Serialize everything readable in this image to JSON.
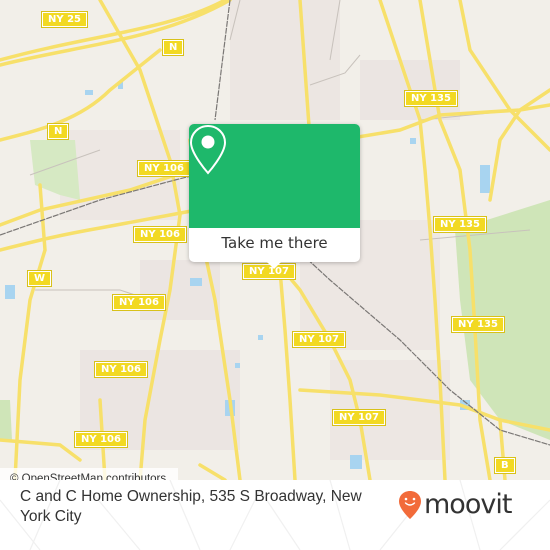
{
  "map": {
    "route_shields": [
      {
        "label": "NY 25"
      },
      {
        "label": "N"
      },
      {
        "label": "N"
      },
      {
        "label": "NY 106"
      },
      {
        "label": "NY 106"
      },
      {
        "label": "W"
      },
      {
        "label": "NY 106"
      },
      {
        "label": "NY 106"
      },
      {
        "label": "NY 106"
      },
      {
        "label": "NY 135"
      },
      {
        "label": "NY 135"
      },
      {
        "label": "NY 135"
      },
      {
        "label": "NY 107"
      },
      {
        "label": "NY 107"
      },
      {
        "label": "NY 107"
      },
      {
        "label": "B"
      }
    ],
    "attribution": "© OpenStreetMap contributors"
  },
  "popup": {
    "icon": "map-pin-icon",
    "button_label": "Take me there",
    "color": "#1eb86b"
  },
  "footer": {
    "address": "C and C Home Ownership, 535 S Broadway, New York City",
    "logo_text": "moovit",
    "logo_color": "#f26b3a"
  }
}
